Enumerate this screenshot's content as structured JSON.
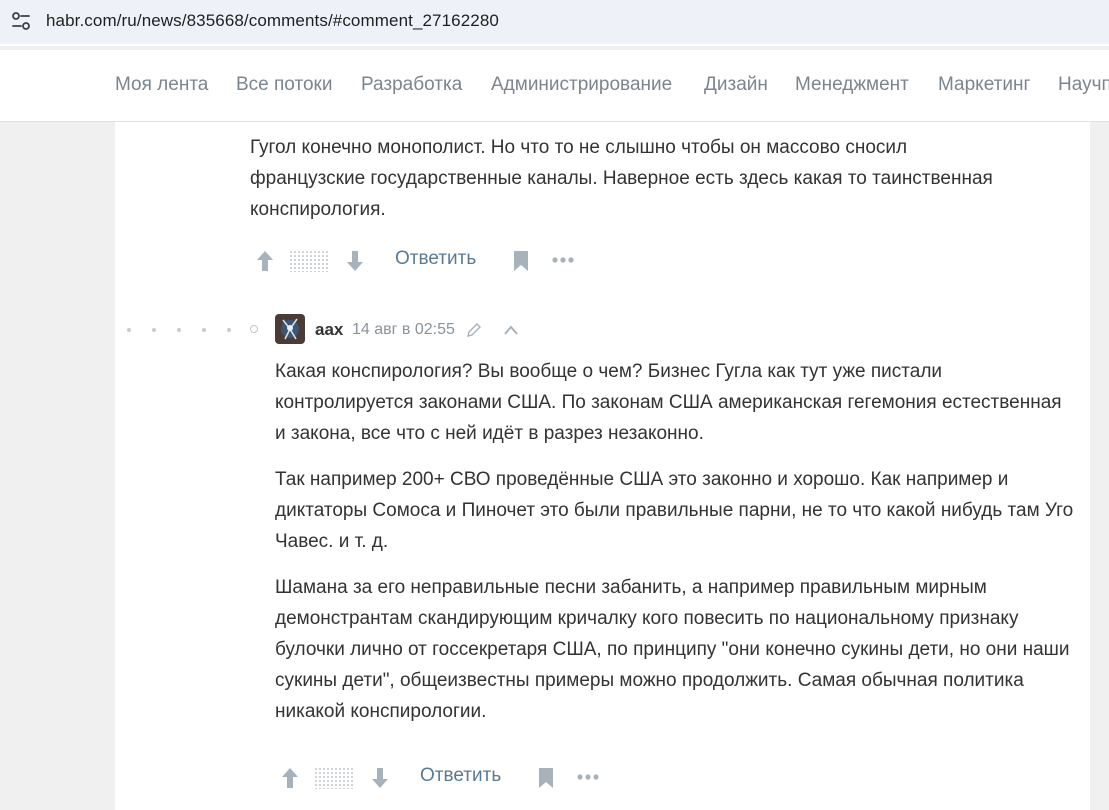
{
  "browser": {
    "url": "habr.com/ru/news/835668/comments/#comment_27162280"
  },
  "nav": {
    "items": [
      "Моя лента",
      "Все потоки",
      "Разработка",
      "Администрирование",
      "Дизайн",
      "Менеджмент",
      "Маркетинг",
      "Научп"
    ]
  },
  "comments": [
    {
      "text": [
        "Гугол конечно монополист. Но что то не слышно чтобы он массово сносил французские государственные каналы. Наверное есть здесь какая то таинственная конспирология."
      ],
      "reply_label": "Ответить"
    },
    {
      "author": "aax",
      "date": "14 авг в 02:55",
      "text": [
        "Какая конспирология? Вы вообще о чем? Бизнес Гугла как тут уже пистали контролируется законами США. По законам США американская гегемония естественная и закона, все что с ней идёт в разрез незаконно.",
        "Так например 200+ СВО проведённые США это законно и хорошо. Как например и диктаторы Сомоса и Пиночет это были правильные парни, не то что какой нибудь там Уго Чавес. и т. д.",
        "Шамана за его неправильные песни забанить, а например правильным мирным демонстрантам скандирующим кричалку кого повесить по национальному признаку булочки лично от госсекретаря США, по принципу \"они конечно сукины дети, но они наши сукины дети\", общеизвестны примеры можно продолжить. Самая обычная политика никакой конспирологии."
      ],
      "reply_label": "Ответить"
    }
  ],
  "colors": {
    "accent_link": "#5b7a94",
    "nav_text": "#7b8590",
    "icon_gray": "#a7b2ba"
  }
}
